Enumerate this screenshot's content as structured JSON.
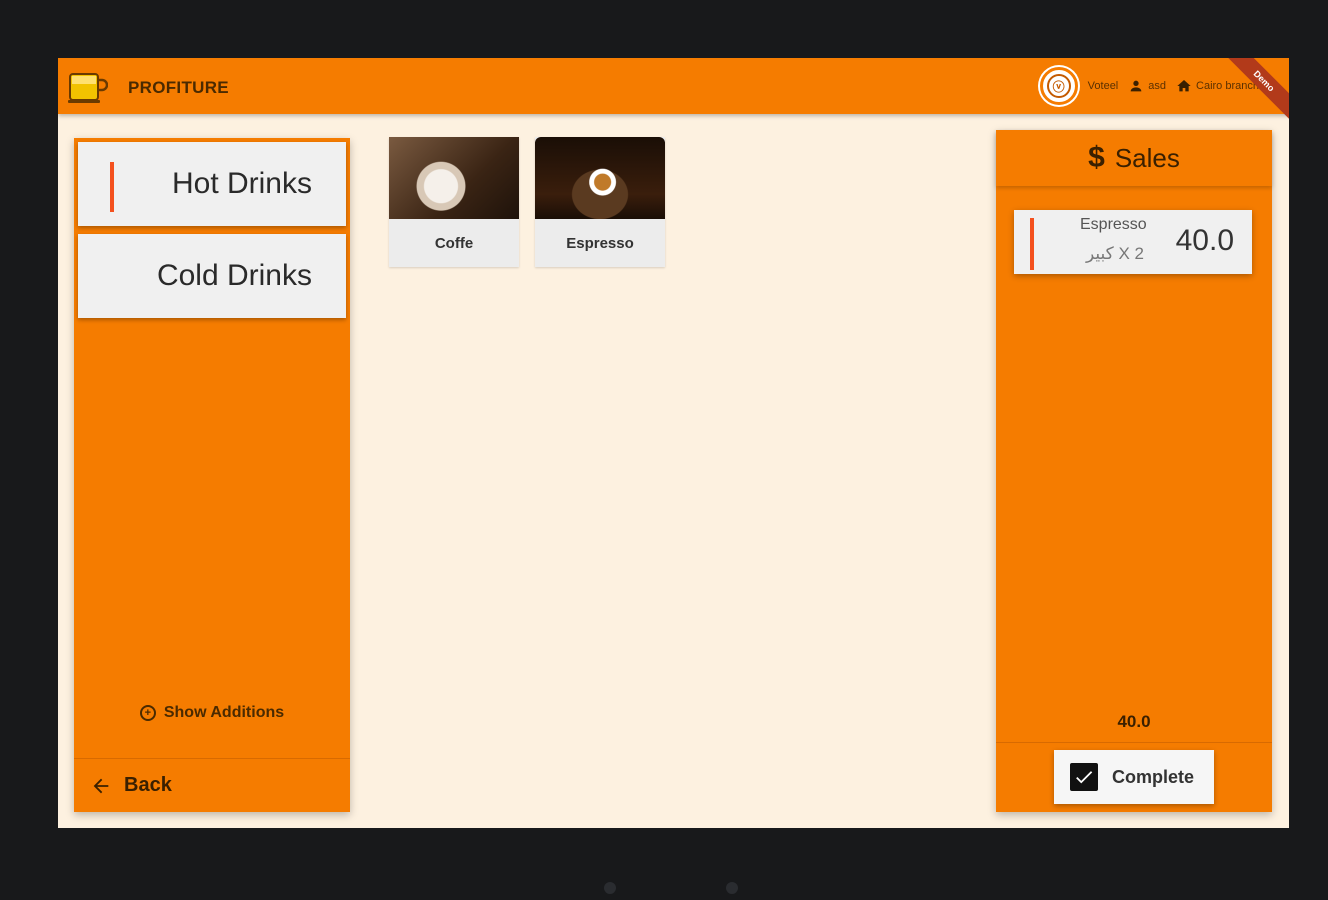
{
  "app": {
    "title": "PROFITURE",
    "ribbon": "Demo"
  },
  "appbar": {
    "avatar_glyph": "ⓥ",
    "user_label": "Voteel",
    "account_label": "asd",
    "branch_label": "Cairo branch"
  },
  "categories": [
    {
      "label": "Hot Drinks",
      "selected": true
    },
    {
      "label": "Cold Drinks",
      "selected": false
    }
  ],
  "left_panel": {
    "show_additions": "Show Additions",
    "back": "Back"
  },
  "products": [
    {
      "name": "Coffe"
    },
    {
      "name": "Espresso"
    }
  ],
  "sales": {
    "title": "Sales",
    "orders": [
      {
        "name": "Espresso",
        "qty": "كبير X 2",
        "price": "40.0"
      }
    ],
    "total": "40.0",
    "complete_label": "Complete"
  },
  "colors": {
    "accent": "#f57c00",
    "marker": "#f4511e",
    "background": "#fdf1e0"
  }
}
